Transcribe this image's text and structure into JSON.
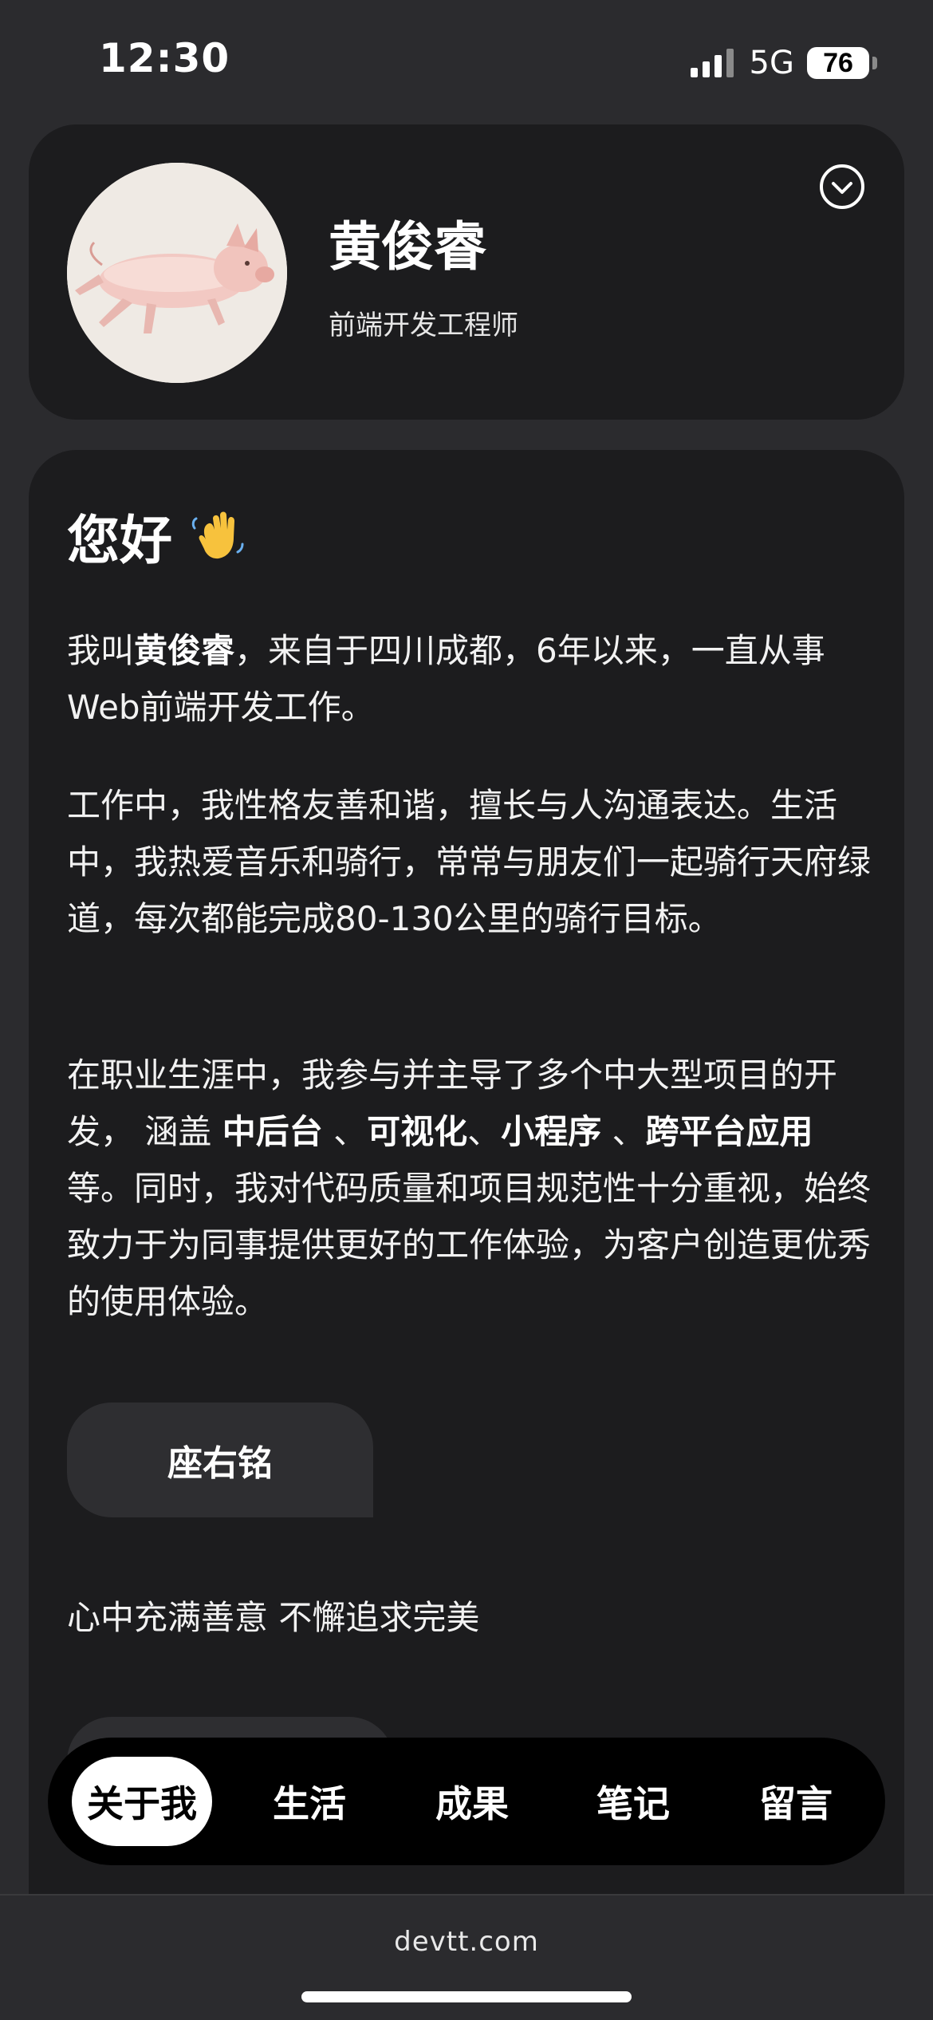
{
  "status_bar": {
    "time": "12:30",
    "network": "5G",
    "battery": "76"
  },
  "profile": {
    "name": "黄俊睿",
    "title": "前端开发工程师",
    "avatar_icon": "pig-avatar"
  },
  "about": {
    "greeting": "您好",
    "p1_a": "我叫",
    "p1_name": "黄俊睿",
    "p1_b": "，来自于四川成都，6年以来，一直从事Web前端开发工作。",
    "p2": "工作中，我性格友善和谐，擅长与人沟通表达。生活中，我热爱音乐和骑行，常常与朋友们一起骑行天府绿道，每次都能完成80-130公里的骑行目标。",
    "p3_a": "在职业生涯中，我参与并主导了多个中大型项目的开发， 涵盖 ",
    "p3_k1": "中后台",
    "p3_s1": " 、",
    "p3_k2": "可视化",
    "p3_s2": "、",
    "p3_k3": "小程序",
    "p3_s3": " 、",
    "p3_k4": "跨平台应用",
    "p3_b": " 等。同时，我对代码质量和项目规范性十分重视，始终致力于为同事提供更好的工作体验，为客户创造更优秀的使用体验。",
    "motto_label": "座右铭",
    "motto_text": "心中充满善意 不懈追求完美"
  },
  "nav": {
    "items": [
      "关于我",
      "生活",
      "成果",
      "笔记",
      "留言"
    ],
    "active_index": 0
  },
  "browser": {
    "url": "devtt.com"
  }
}
